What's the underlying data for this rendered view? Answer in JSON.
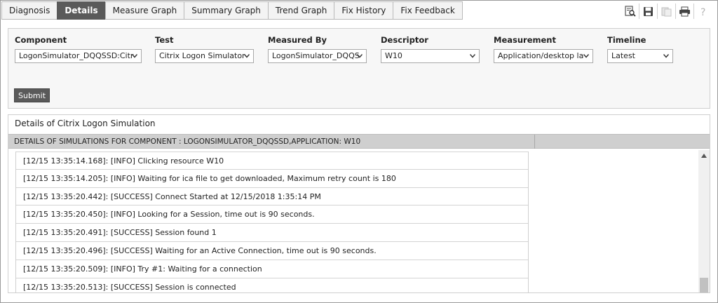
{
  "tabs": [
    {
      "label": "Diagnosis",
      "active": false
    },
    {
      "label": "Details",
      "active": true
    },
    {
      "label": "Measure Graph",
      "active": false
    },
    {
      "label": "Summary Graph",
      "active": false
    },
    {
      "label": "Trend Graph",
      "active": false
    },
    {
      "label": "Fix History",
      "active": false
    },
    {
      "label": "Fix Feedback",
      "active": false
    }
  ],
  "toolbar": {
    "icons": [
      "search-report-icon",
      "save-icon",
      "export-icon",
      "print-icon",
      "help-icon"
    ]
  },
  "filters": {
    "component": {
      "label": "Component",
      "value": "LogonSimulator_DQQSSD:Citr"
    },
    "test": {
      "label": "Test",
      "value": "Citrix Logon Simulator"
    },
    "measured_by": {
      "label": "Measured By",
      "value": "LogonSimulator_DQQS"
    },
    "descriptor": {
      "label": "Descriptor",
      "value": "W10"
    },
    "measurement": {
      "label": "Measurement",
      "value": "Application/desktop la"
    },
    "timeline": {
      "label": "Timeline",
      "value": "Latest"
    },
    "submit_label": "Submit"
  },
  "details": {
    "title": "Details of Citrix Logon Simulation",
    "header": "DETAILS OF SIMULATIONS FOR COMPONENT : LOGONSIMULATOR_DQQSSD,APPLICATION: W10",
    "log": [
      "[12/15  13:35:14.168]: [INFO] Clicking resource W10",
      "[12/15  13:35:14.205]: [INFO] Waiting for ica file to get downloaded, Maximum retry count is 180",
      "[12/15  13:35:20.442]: [SUCCESS] Connect Started at 12/15/2018 1:35:14 PM",
      "[12/15  13:35:20.450]: [INFO] Looking for a Session, time out is 90 seconds.",
      "[12/15  13:35:20.491]: [SUCCESS] Session found 1",
      "[12/15  13:35:20.496]: [SUCCESS] Waiting for an Active Connection, time out is 90 seconds.",
      "[12/15  13:35:20.509]: [INFO] Try #1: Waiting for a connection",
      "[12/15  13:35:20.513]: [SUCCESS] Session is connected"
    ]
  }
}
